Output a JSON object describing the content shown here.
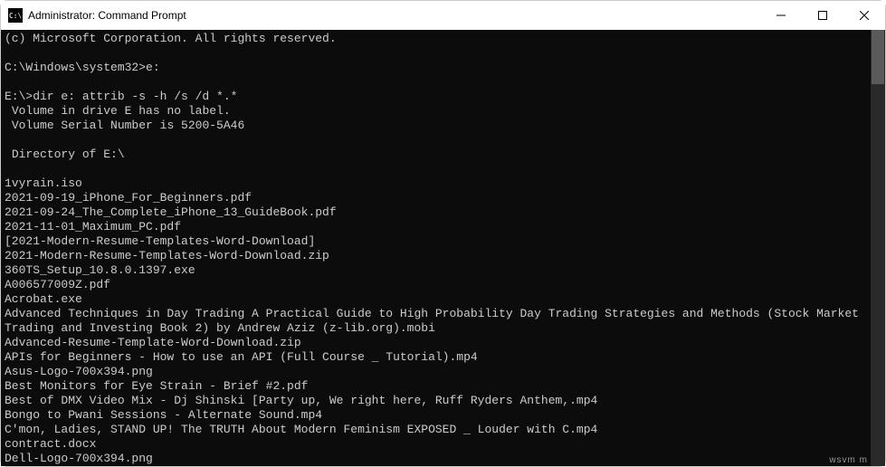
{
  "window": {
    "title": "Administrator: Command Prompt",
    "icon_text": "C:\\"
  },
  "terminal": {
    "lines": [
      "(c) Microsoft Corporation. All rights reserved.",
      "",
      "C:\\Windows\\system32>e:",
      "",
      "E:\\>dir e: attrib -s -h /s /d *.*",
      " Volume in drive E has no label.",
      " Volume Serial Number is 5200-5A46",
      "",
      " Directory of E:\\",
      "",
      "1vyrain.iso",
      "2021-09-19_iPhone_For_Beginners.pdf",
      "2021-09-24_The_Complete_iPhone_13_GuideBook.pdf",
      "2021-11-01_Maximum_PC.pdf",
      "[2021-Modern-Resume-Templates-Word-Download]",
      "2021-Modern-Resume-Templates-Word-Download.zip",
      "360TS_Setup_10.8.0.1397.exe",
      "A006577009Z.pdf",
      "Acrobat.exe",
      "Advanced Techniques in Day Trading A Practical Guide to High Probability Day Trading Strategies and Methods (Stock Market Trading and Investing Book 2) by Andrew Aziz (z-lib.org).mobi",
      "Advanced-Resume-Template-Word-Download.zip",
      "APIs for Beginners - How to use an API (Full Course _ Tutorial).mp4",
      "Asus-Logo-700x394.png",
      "Best Monitors for Eye Strain - Brief #2.pdf",
      "Best of DMX Video Mix - Dj Shinski [Party up, We right here, Ruff Ryders Anthem,.mp4",
      "Bongo to Pwani Sessions - Alternate Sound.mp4",
      "C'mon, Ladies, STAND UP! The TRUTH About Modern Feminism EXPOSED _ Louder with C.mp4",
      "contract.docx",
      "Dell-Logo-700x394.png"
    ]
  },
  "watermark": "wsvm m"
}
